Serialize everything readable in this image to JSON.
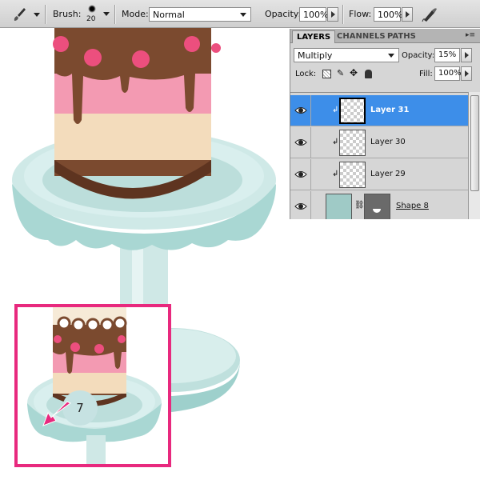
{
  "options_bar": {
    "brush_label": "Brush:",
    "brush_size": "20",
    "mode_label": "Mode:",
    "mode_value": "Normal",
    "opacity_label": "Opacity:",
    "opacity_value": "100%",
    "flow_label": "Flow:",
    "flow_value": "100%",
    "icons": [
      "brush-tool-icon",
      "airbrush-icon"
    ]
  },
  "layers_panel": {
    "tabs": [
      {
        "label": "LAYERS",
        "active": true
      },
      {
        "label": "CHANNELS",
        "active": false
      },
      {
        "label": "PATHS",
        "active": false
      }
    ],
    "blend_mode": "Multiply",
    "opacity_label": "Opacity:",
    "opacity_value": "15%",
    "lock_label": "Lock:",
    "fill_label": "Fill:",
    "fill_value": "100%",
    "layers": [
      {
        "name": "Layer 31",
        "selected": true,
        "clipped": true
      },
      {
        "name": "Layer 30",
        "selected": false,
        "clipped": true
      },
      {
        "name": "Layer 29",
        "selected": false,
        "clipped": true
      },
      {
        "name": "Shape 8",
        "selected": false,
        "clipped": false
      }
    ]
  },
  "annotation": {
    "step_number": "7",
    "accent_color": "#e8297e"
  }
}
